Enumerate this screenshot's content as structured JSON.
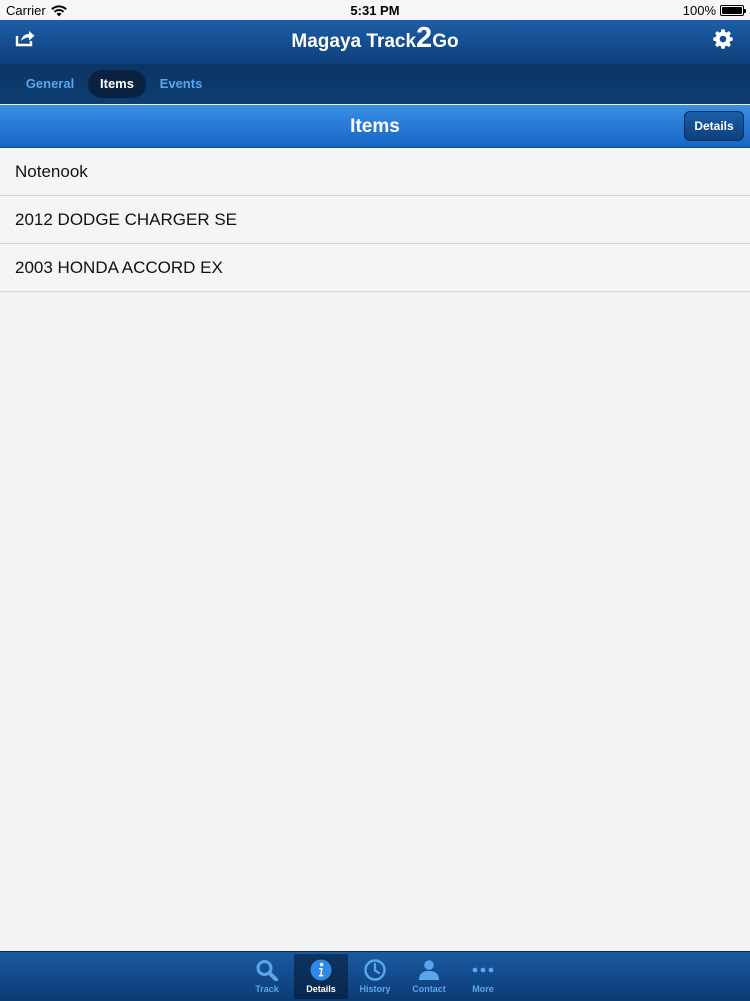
{
  "status_bar": {
    "carrier": "Carrier",
    "time": "5:31 PM",
    "battery": "100%",
    "battery_level": 1.0
  },
  "nav": {
    "title_left": "Magaya Track",
    "title_big": "2",
    "title_right": "Go",
    "left_icon": "share-icon",
    "right_icon": "gear-icon"
  },
  "segments": [
    {
      "label": "General",
      "active": false
    },
    {
      "label": "Items",
      "active": true
    },
    {
      "label": "Events",
      "active": false
    }
  ],
  "section": {
    "title": "Items",
    "details_label": "Details"
  },
  "items": [
    {
      "label": "Notenook"
    },
    {
      "label": "2012 DODGE CHARGER SE"
    },
    {
      "label": "2003 HONDA ACCORD EX"
    }
  ],
  "tabs": [
    {
      "label": "Track",
      "icon": "search-icon",
      "active": false
    },
    {
      "label": "Details",
      "icon": "info-icon",
      "active": true
    },
    {
      "label": "History",
      "icon": "clock-icon",
      "active": false
    },
    {
      "label": "Contact",
      "icon": "person-icon",
      "active": false
    },
    {
      "label": "More",
      "icon": "more-icon",
      "active": false
    }
  ],
  "colors": {
    "nav_blue": "#1d5ea8",
    "header_blue": "#2a7fd8",
    "tab_inactive": "#5aa6ea",
    "tab_active": "#ffffff"
  }
}
